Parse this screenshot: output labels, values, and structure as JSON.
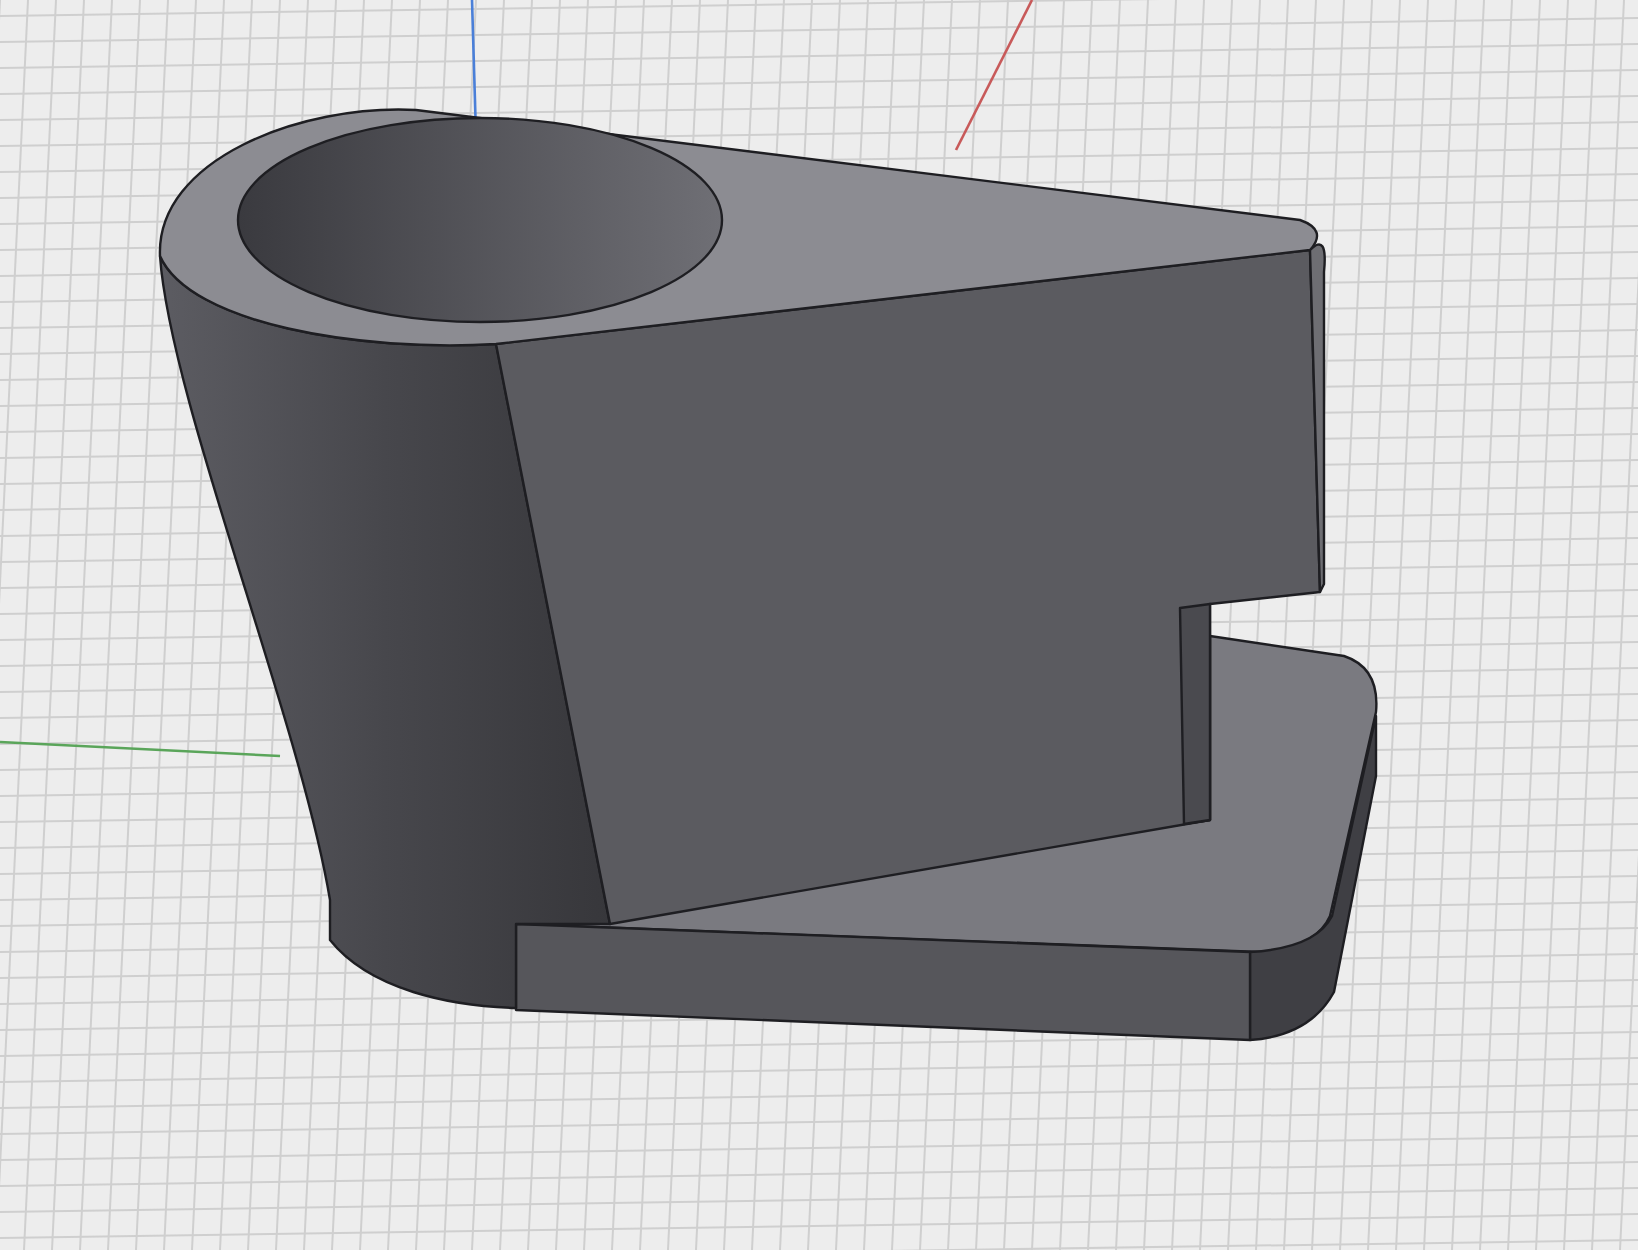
{
  "viewport": {
    "grid": true,
    "axes": [
      {
        "kind": "vertical",
        "color": "#4a7fd8"
      },
      {
        "kind": "x",
        "color": "#c85a5a"
      },
      {
        "kind": "y",
        "color": "#5aa55a"
      }
    ]
  }
}
